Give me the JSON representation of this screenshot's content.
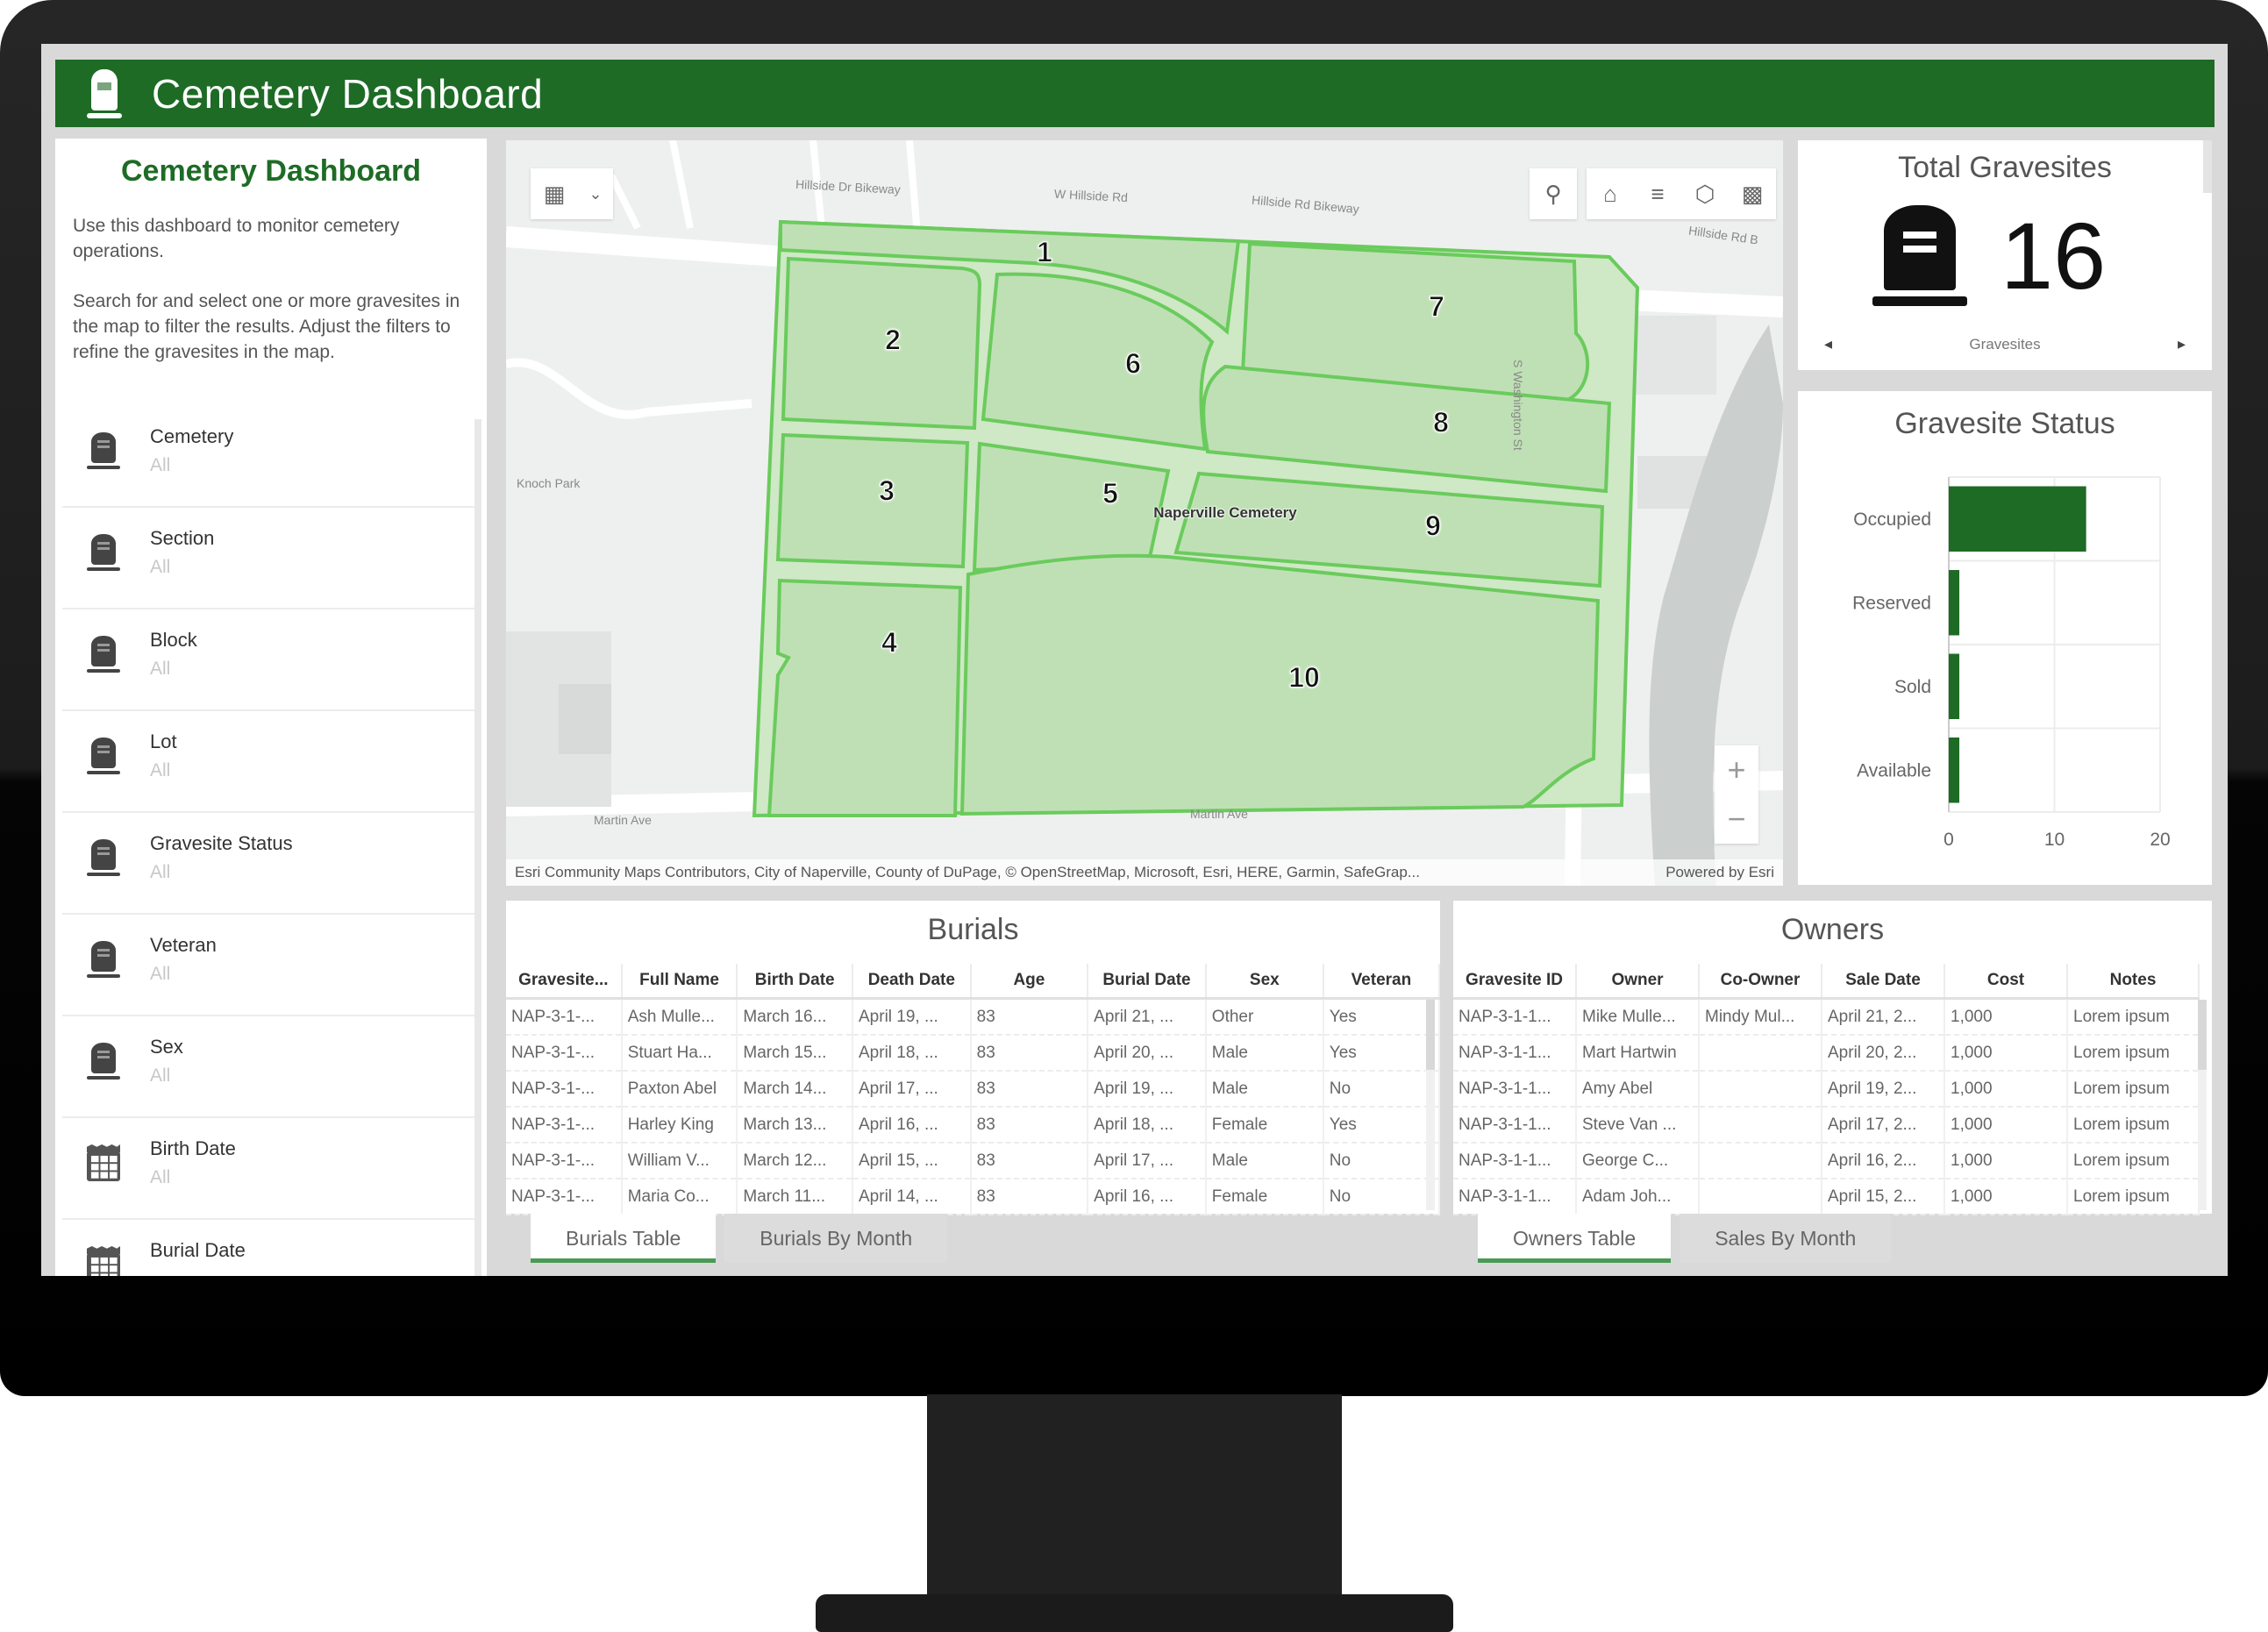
{
  "app": {
    "title": "Cemetery Dashboard",
    "accent_color": "#1e6b26",
    "logo_icon": "tombstone-icon"
  },
  "sidebar": {
    "title": "Cemetery Dashboard",
    "description": [
      "Use this dashboard to monitor cemetery operations.",
      "Search for and select one or more gravesites in the map to filter the results. Adjust the filters to refine the gravesites in the map."
    ],
    "filters": [
      {
        "label": "Cemetery",
        "value": "All",
        "icon": "tombstone-icon"
      },
      {
        "label": "Section",
        "value": "All",
        "icon": "tombstone-icon"
      },
      {
        "label": "Block",
        "value": "All",
        "icon": "tombstone-icon"
      },
      {
        "label": "Lot",
        "value": "All",
        "icon": "tombstone-icon"
      },
      {
        "label": "Gravesite Status",
        "value": "All",
        "icon": "tombstone-icon"
      },
      {
        "label": "Veteran",
        "value": "All",
        "icon": "tombstone-icon"
      },
      {
        "label": "Sex",
        "value": "All",
        "icon": "tombstone-icon"
      },
      {
        "label": "Birth Date",
        "value": "All",
        "icon": "calendar-icon"
      },
      {
        "label": "Burial Date",
        "value": "",
        "icon": "calendar-icon"
      }
    ]
  },
  "map": {
    "toolbar_left": [
      "basemap-gallery-icon",
      "chevron-down-icon"
    ],
    "toolbar_right": [
      "search-icon",
      "home-icon",
      "legend-icon",
      "layers-icon",
      "qr-code-icon"
    ],
    "street_labels": [
      "Hillside Dr Bikeway",
      "W Hillside Rd",
      "Hillside Rd Bikeway",
      "Hillside Rd B",
      "S Washington St",
      "Knoch Park",
      "Martin Ave",
      "Martin Ave"
    ],
    "place_label": "Naperville Cemetery",
    "sections": [
      "1",
      "2",
      "3",
      "4",
      "5",
      "6",
      "7",
      "8",
      "9",
      "10"
    ],
    "attribution": "Esri Community Maps Contributors, City of Naperville, County of DuPage, © OpenStreetMap, Microsoft, Esri, HERE, Garmin, SafeGrap...",
    "powered_by": "Powered by Esri",
    "zoom_in": "+",
    "zoom_out": "−",
    "fill_color": "#bfe0b5",
    "outline_color": "#6acb5c"
  },
  "indicator": {
    "title": "Total Gravesites",
    "value": "16",
    "label": "Gravesites",
    "prev": "◂",
    "next": "▸"
  },
  "chart_data": {
    "type": "bar",
    "orientation": "horizontal",
    "title": "Gravesite Status",
    "categories": [
      "Occupied",
      "Reserved",
      "Sold",
      "Available"
    ],
    "values": [
      13,
      1,
      1,
      1
    ],
    "xlim": [
      0,
      20
    ],
    "xticks": [
      "0",
      "10",
      "20"
    ],
    "xlabel": "",
    "ylabel": "",
    "grid": true,
    "bar_color": "#1e6b26"
  },
  "burials": {
    "title": "Burials",
    "columns": [
      "Gravesite...",
      "Full Name",
      "Birth Date",
      "Death Date",
      "Age",
      "Burial Date",
      "Sex",
      "Veteran"
    ],
    "rows": [
      [
        "NAP-3-1-...",
        "Ash Mulle...",
        "March 16...",
        "April 19, ...",
        "83",
        "April 21, ...",
        "Other",
        "Yes"
      ],
      [
        "NAP-3-1-...",
        "Stuart Ha...",
        "March 15...",
        "April 18, ...",
        "83",
        "April 20, ...",
        "Male",
        "Yes"
      ],
      [
        "NAP-3-1-...",
        "Paxton Abel",
        "March 14...",
        "April 17, ...",
        "83",
        "April 19, ...",
        "Male",
        "No"
      ],
      [
        "NAP-3-1-...",
        "Harley King",
        "March 13...",
        "April 16, ...",
        "83",
        "April 18, ...",
        "Female",
        "Yes"
      ],
      [
        "NAP-3-1-...",
        "William V...",
        "March 12...",
        "April 15, ...",
        "83",
        "April 17, ...",
        "Male",
        "No"
      ],
      [
        "NAP-3-1-...",
        "Maria Co...",
        "March 11...",
        "April 14, ...",
        "83",
        "April 16, ...",
        "Female",
        "No"
      ]
    ],
    "tabs": [
      "Burials Table",
      "Burials By Month"
    ],
    "active_tab": 0
  },
  "owners": {
    "title": "Owners",
    "columns": [
      "Gravesite ID",
      "Owner",
      "Co-Owner",
      "Sale Date",
      "Cost",
      "Notes"
    ],
    "rows": [
      [
        "NAP-3-1-1...",
        "Mike Mulle...",
        "Mindy Mul...",
        "April 21, 2...",
        "1,000",
        "Lorem ipsum"
      ],
      [
        "NAP-3-1-1...",
        "Mart Hartwin",
        "",
        "April 20, 2...",
        "1,000",
        "Lorem ipsum"
      ],
      [
        "NAP-3-1-1...",
        "Amy Abel",
        "",
        "April 19, 2...",
        "1,000",
        "Lorem ipsum"
      ],
      [
        "NAP-3-1-1...",
        "Steve Van ...",
        "",
        "April 17, 2...",
        "1,000",
        "Lorem ipsum"
      ],
      [
        "NAP-3-1-1...",
        "George C...",
        "",
        "April 16, 2...",
        "1,000",
        "Lorem ipsum"
      ],
      [
        "NAP-3-1-1...",
        "Adam Joh...",
        "",
        "April 15, 2...",
        "1,000",
        "Lorem ipsum"
      ]
    ],
    "tabs": [
      "Owners Table",
      "Sales By Month"
    ],
    "active_tab": 0
  }
}
